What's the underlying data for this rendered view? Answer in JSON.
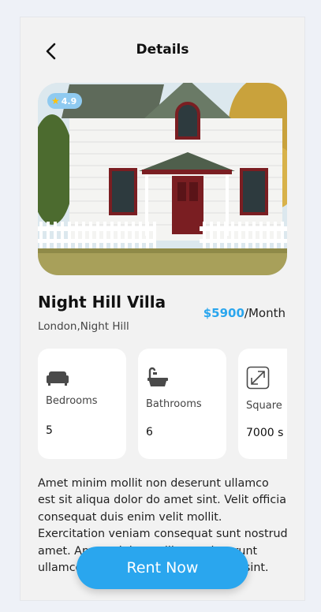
{
  "header": {
    "title": "Details"
  },
  "property": {
    "rating": "4.9",
    "name": "Night Hill Villa",
    "location": "London,Night Hill",
    "price": "$5900",
    "price_period": "/Month"
  },
  "features": [
    {
      "icon": "sofa-icon",
      "label": "Bedrooms",
      "value": "5"
    },
    {
      "icon": "bathtub-icon",
      "label": "Bathrooms",
      "value": "6"
    },
    {
      "icon": "expand-icon",
      "label": "Square",
      "value": "7000 s"
    }
  ],
  "description": "Amet minim mollit non deserunt ullamco est sit aliqua dolor do amet sint. Velit officia consequat duis enim velit mollit. Exercitation veniam consequat sunt nostrud amet. Amet minim mollit non deserunt ullamco est sit aliqua dolor do amet sint.",
  "actions": {
    "rent_label": "Rent Now"
  },
  "colors": {
    "accent": "#2aa6ee",
    "background": "#f2f2f2",
    "card": "#ffffff"
  }
}
